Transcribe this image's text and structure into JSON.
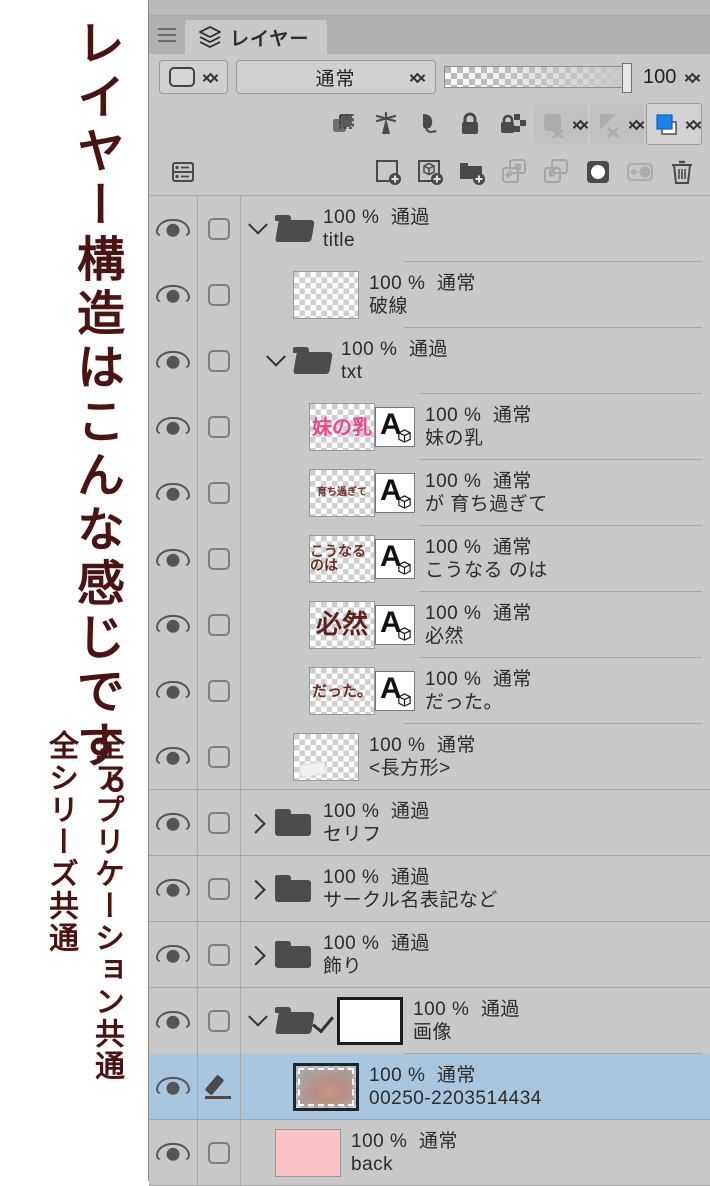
{
  "annotation": {
    "main_text": "レイヤー構造はこんな感じです。",
    "sub_text_1": "全シリーズ共通",
    "sub_text_2": "全アプリケーション共通"
  },
  "panel": {
    "tab_label": "レイヤー",
    "menu_icon": "hamburger-menu-icon",
    "tab_icon": "layers-stack-icon"
  },
  "blend_bar": {
    "mask_label": "",
    "blend_mode": "通常",
    "opacity_value": "100",
    "opacity_percent": 100
  },
  "property_icons": [
    {
      "name": "clip-to-layer-below-icon",
      "label": "下のレイヤーでクリッピング",
      "enabled": true
    },
    {
      "name": "reference-layer-icon",
      "label": "参照レイヤーに設定",
      "enabled": true
    },
    {
      "name": "draft-layer-icon",
      "label": "下書きレイヤーに設定",
      "enabled": true
    },
    {
      "name": "lock-layer-icon",
      "label": "レイヤーをロック",
      "enabled": true
    },
    {
      "name": "lock-transparent-pixels-icon",
      "label": "透明ピクセルをロック",
      "enabled": true
    },
    {
      "name": "mask-enable-icon",
      "label": "レイヤーマスクを有効化",
      "enabled": false
    },
    {
      "name": "ruler-enable-icon",
      "label": "定規の表示範囲",
      "enabled": false
    },
    {
      "name": "palette-color-icon",
      "label": "レイヤーカラー",
      "enabled": true,
      "color": "#1a84ed"
    }
  ],
  "tool_icons": [
    {
      "name": "layer-settings-icon",
      "label": "レイヤー設定",
      "enabled": true
    },
    {
      "name": "new-raster-layer-icon",
      "label": "新規ラスターレイヤー",
      "enabled": true
    },
    {
      "name": "new-3d-layer-icon",
      "label": "新規レイヤー",
      "enabled": true
    },
    {
      "name": "new-layer-folder-icon",
      "label": "新規レイヤーフォルダー",
      "enabled": true
    },
    {
      "name": "transfer-down-icon",
      "label": "下のレイヤーに転写",
      "enabled": false
    },
    {
      "name": "merge-down-icon",
      "label": "下のレイヤーと結合",
      "enabled": false
    },
    {
      "name": "create-layer-mask-icon",
      "label": "レイヤーマスク作成",
      "enabled": true
    },
    {
      "name": "create-from-selection-icon",
      "label": "選択範囲外をマスク",
      "enabled": false
    },
    {
      "name": "delete-layer-icon",
      "label": "レイヤーを削除",
      "enabled": true
    }
  ],
  "layers": [
    {
      "id": "title",
      "name": "title",
      "opacity": "100 %",
      "blend": "通過",
      "type": "folder",
      "indent": 0,
      "expanded": true,
      "visible": true,
      "selected": false,
      "thumb": "none"
    },
    {
      "id": "hasen",
      "name": "破線",
      "opacity": "100 %",
      "blend": "通常",
      "type": "raster",
      "indent": 1,
      "visible": true,
      "selected": false,
      "thumb": "transparent"
    },
    {
      "id": "txt",
      "name": "txt",
      "opacity": "100 %",
      "blend": "通過",
      "type": "folder",
      "indent": 1,
      "expanded": true,
      "visible": true,
      "selected": false,
      "thumb": "none"
    },
    {
      "id": "imouto",
      "name": "妹の乳",
      "opacity": "100 %",
      "blend": "通常",
      "type": "text",
      "indent": 2,
      "visible": true,
      "selected": false,
      "thumb": "text",
      "thumb_text": "妹の乳",
      "thumb_color": "#f2468c",
      "thumb_size": 20
    },
    {
      "id": "sodachi",
      "name": "が 育ち過ぎて",
      "opacity": "100 %",
      "blend": "通常",
      "type": "text",
      "indent": 2,
      "visible": true,
      "selected": false,
      "thumb": "text",
      "thumb_text": "育ち過ぎて",
      "thumb_color": "#6b3028",
      "thumb_size": 10
    },
    {
      "id": "kounaru",
      "name": "こうなる のは",
      "opacity": "100 %",
      "blend": "通常",
      "type": "text",
      "indent": 2,
      "visible": true,
      "selected": false,
      "thumb": "text",
      "thumb_text": "こうなるのは",
      "thumb_color": "#6b2b23",
      "thumb_size": 14
    },
    {
      "id": "hitsuzen",
      "name": "必然",
      "opacity": "100 %",
      "blend": "通常",
      "type": "text",
      "indent": 2,
      "visible": true,
      "selected": false,
      "thumb": "text",
      "thumb_text": "必然",
      "thumb_color": "#5e201c",
      "thumb_size": 26
    },
    {
      "id": "datta",
      "name": "だった。",
      "opacity": "100 %",
      "blend": "通常",
      "type": "text",
      "indent": 2,
      "visible": true,
      "selected": false,
      "thumb": "text",
      "thumb_text": "だった。",
      "thumb_color": "#6b2b23",
      "thumb_size": 15
    },
    {
      "id": "rect",
      "name": "<長方形>",
      "opacity": "100 %",
      "blend": "通常",
      "type": "raster",
      "indent": 1,
      "visible": true,
      "selected": false,
      "thumb": "rect-fragment"
    },
    {
      "id": "serifu",
      "name": "セリフ",
      "opacity": "100 %",
      "blend": "通過",
      "type": "folder",
      "indent": 0,
      "expanded": false,
      "visible": true,
      "selected": false,
      "thumb": "none"
    },
    {
      "id": "circle-name",
      "name": "サークル名表記など",
      "opacity": "100 %",
      "blend": "通過",
      "type": "folder",
      "indent": 0,
      "expanded": false,
      "visible": true,
      "selected": false,
      "thumb": "none"
    },
    {
      "id": "kazari",
      "name": "飾り",
      "opacity": "100 %",
      "blend": "通過",
      "type": "folder",
      "indent": 0,
      "expanded": false,
      "visible": true,
      "selected": false,
      "thumb": "none"
    },
    {
      "id": "gazou",
      "name": "画像",
      "opacity": "100 %",
      "blend": "通過",
      "type": "folder",
      "indent": 0,
      "expanded": true,
      "visible": true,
      "selected": false,
      "has_mask": true,
      "thumb": "white"
    },
    {
      "id": "00250",
      "name": "00250-2203514434",
      "opacity": "100 %",
      "blend": "通常",
      "type": "raster",
      "indent": 1,
      "visible": true,
      "selected": true,
      "editing": true,
      "thumb": "image"
    },
    {
      "id": "back",
      "name": "back",
      "opacity": "100 %",
      "blend": "通常",
      "type": "raster",
      "indent": 0,
      "visible": true,
      "selected": false,
      "thumb": "pink",
      "thumb_color": "#fbc4c4"
    }
  ],
  "colors": {
    "panel_bg": "#c8c8c8",
    "selection": "#a8c6de",
    "accent_blue": "#1a84ed",
    "annotation_text": "#4a1412"
  }
}
